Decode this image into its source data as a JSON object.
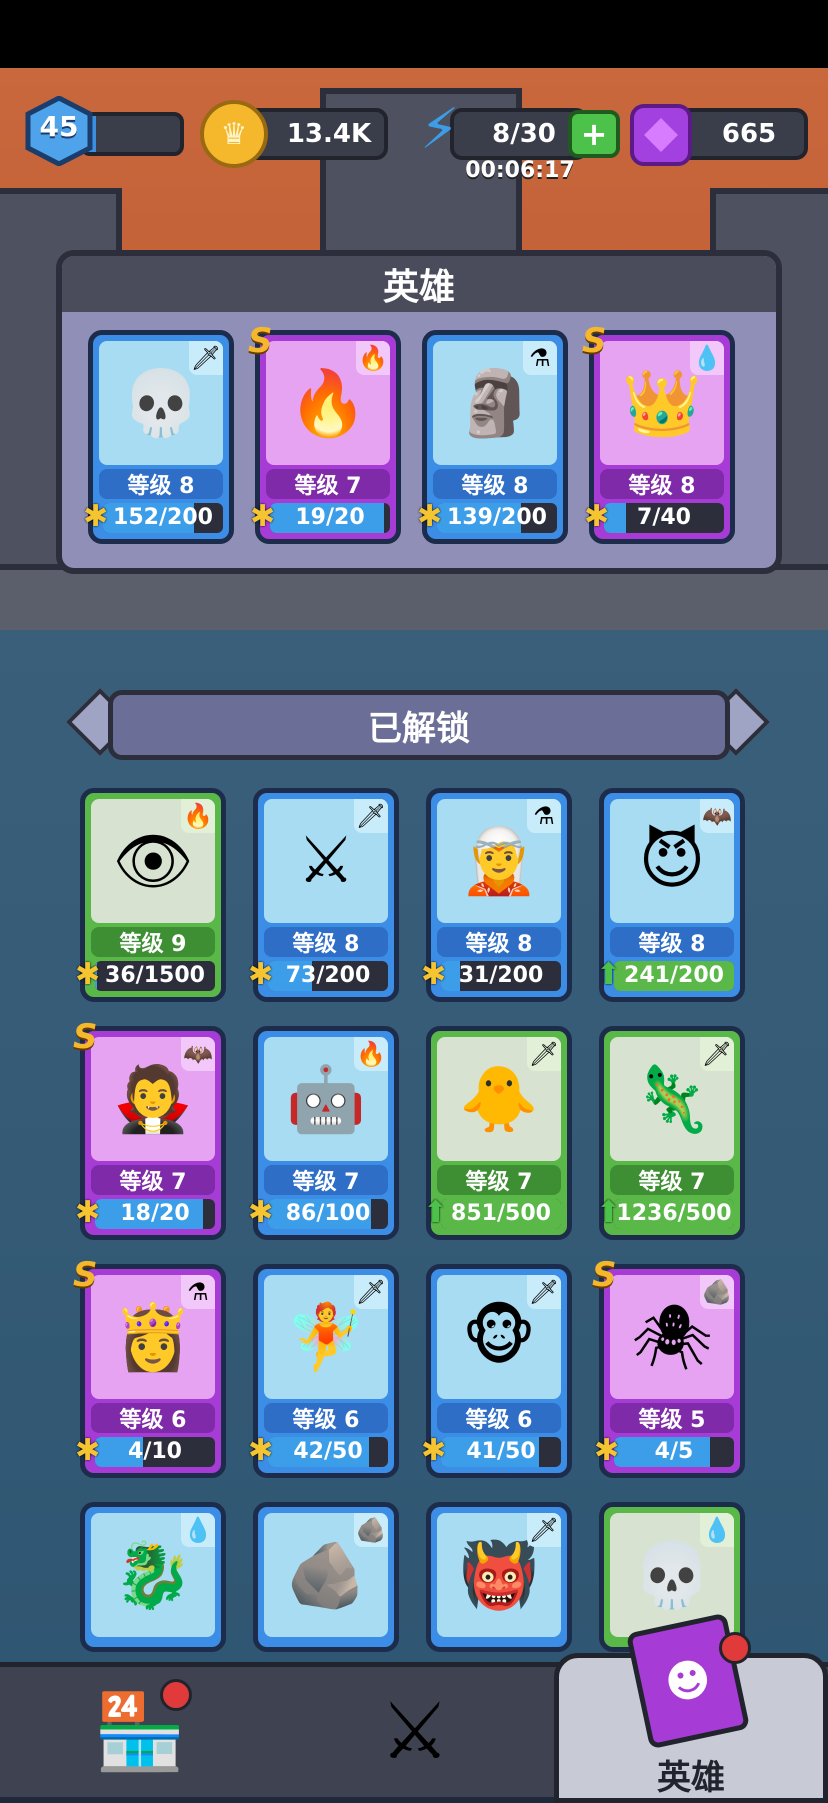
{
  "status": {
    "player_level": "45",
    "xp_fraction": 0.12,
    "gold": "13.4K",
    "energy": "8/30",
    "energy_timer": "00:06:17",
    "gems": "665"
  },
  "hero_panel": {
    "title": "英雄",
    "cards": [
      {
        "name": "skeleton-knight",
        "color": "blue",
        "rank": "",
        "element": "sword",
        "icon": "💀",
        "level": "等级 8",
        "progress": "152/200",
        "fill": 0.76,
        "full": false
      },
      {
        "name": "phoenix-knight",
        "color": "purple",
        "rank": "S",
        "element": "fire",
        "icon": "🔥",
        "level": "等级 7",
        "progress": "19/20",
        "fill": 0.95,
        "full": false
      },
      {
        "name": "stone-golem",
        "color": "blue",
        "rank": "",
        "element": "potion",
        "icon": "🗿",
        "level": "等级 8",
        "progress": "139/200",
        "fill": 0.7,
        "full": false
      },
      {
        "name": "ice-queen",
        "color": "purple",
        "rank": "S",
        "element": "water",
        "icon": "👑",
        "level": "等级 8",
        "progress": "7/40",
        "fill": 0.18,
        "full": false
      }
    ]
  },
  "unlocked": {
    "title": "已解锁",
    "cards": [
      {
        "name": "eye-beast",
        "color": "green",
        "rank": "",
        "element": "fire",
        "icon": "👁",
        "level": "等级 9",
        "progress": "36/1500",
        "fill": 0.02,
        "full": false
      },
      {
        "name": "horned-warrior",
        "color": "blue",
        "rank": "",
        "element": "sword",
        "icon": "⚔",
        "level": "等级 8",
        "progress": "73/200",
        "fill": 0.37,
        "full": false
      },
      {
        "name": "forest-elf",
        "color": "blue",
        "rank": "",
        "element": "potion",
        "icon": "🧝",
        "level": "等级 8",
        "progress": "31/200",
        "fill": 0.16,
        "full": false
      },
      {
        "name": "demon-bat",
        "color": "blue",
        "rank": "",
        "element": "bat",
        "icon": "😈",
        "level": "等级 8",
        "progress": "241/200",
        "fill": 1,
        "full": true
      },
      {
        "name": "vampire",
        "color": "purple",
        "rank": "S",
        "element": "bat",
        "icon": "🧛",
        "level": "等级 7",
        "progress": "18/20",
        "fill": 0.9,
        "full": false
      },
      {
        "name": "mech-rider",
        "color": "blue",
        "rank": "",
        "element": "fire",
        "icon": "🤖",
        "level": "等级 7",
        "progress": "86/100",
        "fill": 0.86,
        "full": false
      },
      {
        "name": "green-angel",
        "color": "green",
        "rank": "",
        "element": "sword",
        "icon": "🐥",
        "level": "等级 7",
        "progress": "851/500",
        "fill": 1,
        "full": true
      },
      {
        "name": "slime-warrior",
        "color": "green",
        "rank": "",
        "element": "sword",
        "icon": "🦎",
        "level": "等级 7",
        "progress": "1236/500",
        "fill": 1,
        "full": true
      },
      {
        "name": "blonde-mage",
        "color": "purple",
        "rank": "S",
        "element": "potion",
        "icon": "👸",
        "level": "等级 6",
        "progress": "4/10",
        "fill": 0.4,
        "full": false
      },
      {
        "name": "winged-archer",
        "color": "blue",
        "rank": "",
        "element": "sword",
        "icon": "🧚",
        "level": "等级 6",
        "progress": "42/50",
        "fill": 0.84,
        "full": false
      },
      {
        "name": "monkey-chief",
        "color": "blue",
        "rank": "",
        "element": "sword",
        "icon": "🐵",
        "level": "等级 6",
        "progress": "41/50",
        "fill": 0.82,
        "full": false
      },
      {
        "name": "crimson-spider",
        "color": "purple",
        "rank": "S",
        "element": "rock",
        "icon": "🕷",
        "level": "等级 5",
        "progress": "4/5",
        "fill": 0.8,
        "full": false
      },
      {
        "name": "sea-serpent",
        "color": "blue",
        "rank": "",
        "element": "water",
        "icon": "🐉",
        "level": "",
        "progress": "",
        "fill": 0,
        "full": false
      },
      {
        "name": "crystal-golem",
        "color": "blue",
        "rank": "",
        "element": "rock",
        "icon": "🪨",
        "level": "",
        "progress": "",
        "fill": 0,
        "full": false
      },
      {
        "name": "orc-brute",
        "color": "blue",
        "rank": "",
        "element": "sword",
        "icon": "👹",
        "level": "",
        "progress": "",
        "fill": 0,
        "full": false
      },
      {
        "name": "skull-dwarf",
        "color": "green",
        "rank": "",
        "element": "water",
        "icon": "💀",
        "level": "",
        "progress": "",
        "fill": 0,
        "full": false
      }
    ]
  },
  "element_icons": {
    "sword": "🗡",
    "fire": "🔥",
    "potion": "⚗",
    "water": "💧",
    "bat": "🦇",
    "rock": "🪨"
  },
  "nav": {
    "shop_icon": "shop-icon",
    "battle_icon": "crossed-swords-icon",
    "hero_label": "英雄"
  }
}
